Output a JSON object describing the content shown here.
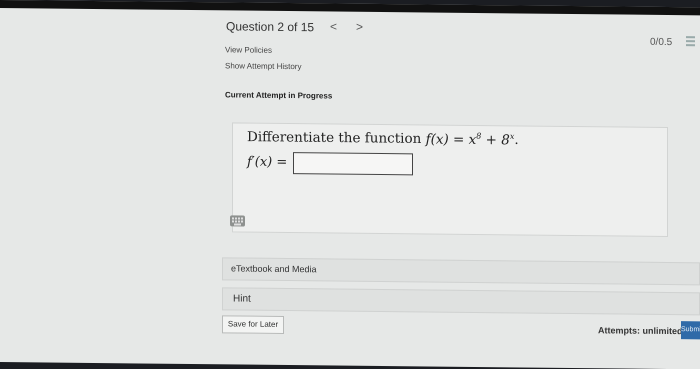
{
  "header": {
    "question_label": "Question 2 of 15",
    "prev_glyph": "<",
    "next_glyph": ">",
    "score": "0/0.5",
    "menu_icon": "list-icon"
  },
  "links": {
    "view_policies": "View Policies",
    "attempt_history": "Show Attempt History"
  },
  "attempt_status": "Current Attempt in Progress",
  "question": {
    "prompt_text": "Differentiate the function",
    "function_lhs": "f(x) = x",
    "exponent_1": "8",
    "plus": " + 8",
    "exponent_2": "x",
    "period": ".",
    "answer_label": "f′(x) =",
    "answer_value": ""
  },
  "icons": {
    "keyboard": "keyboard-icon"
  },
  "panels": {
    "etextbook": "eTextbook and Media",
    "hint": "Hint"
  },
  "footer": {
    "save_label": "Save for Later",
    "attempts_label": "Attempts: unlimited",
    "submit_label": "Submit"
  },
  "colors": {
    "page_bg": "#e6e8e7",
    "submit_bg": "#2f6aa8"
  }
}
